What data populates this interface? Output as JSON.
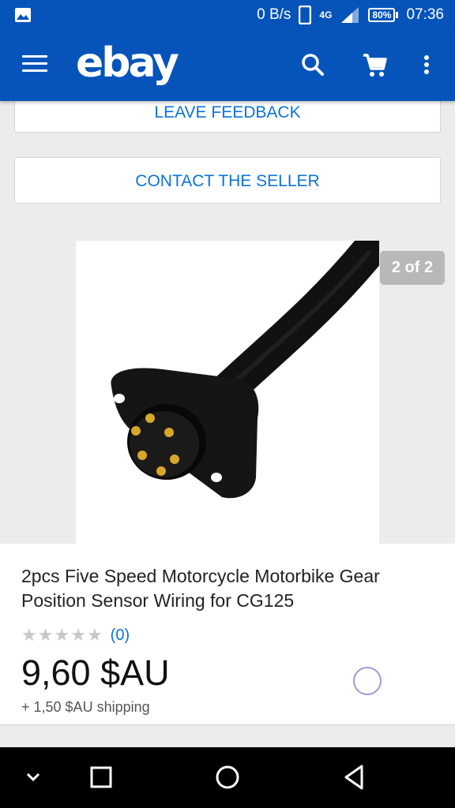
{
  "status_bar": {
    "net_speed": "0 B/s",
    "network": "4G",
    "battery": "80%",
    "time": "07:36"
  },
  "app_bar": {
    "logo": "ebay"
  },
  "actions": {
    "leave_feedback": "LEAVE FEEDBACK",
    "contact_seller": "CONTACT THE SELLER"
  },
  "gallery": {
    "counter": "2 of 2"
  },
  "product": {
    "title": "2pcs Five Speed Motorcycle Motorbike Gear Position Sensor Wiring for CG125",
    "reviews_count": "(0)",
    "rating": 0,
    "price": "9,60 $AU",
    "shipping": "+ 1,50 $AU shipping"
  },
  "colors": {
    "brand_blue": "#0654ba",
    "link_blue": "#0a74da"
  }
}
